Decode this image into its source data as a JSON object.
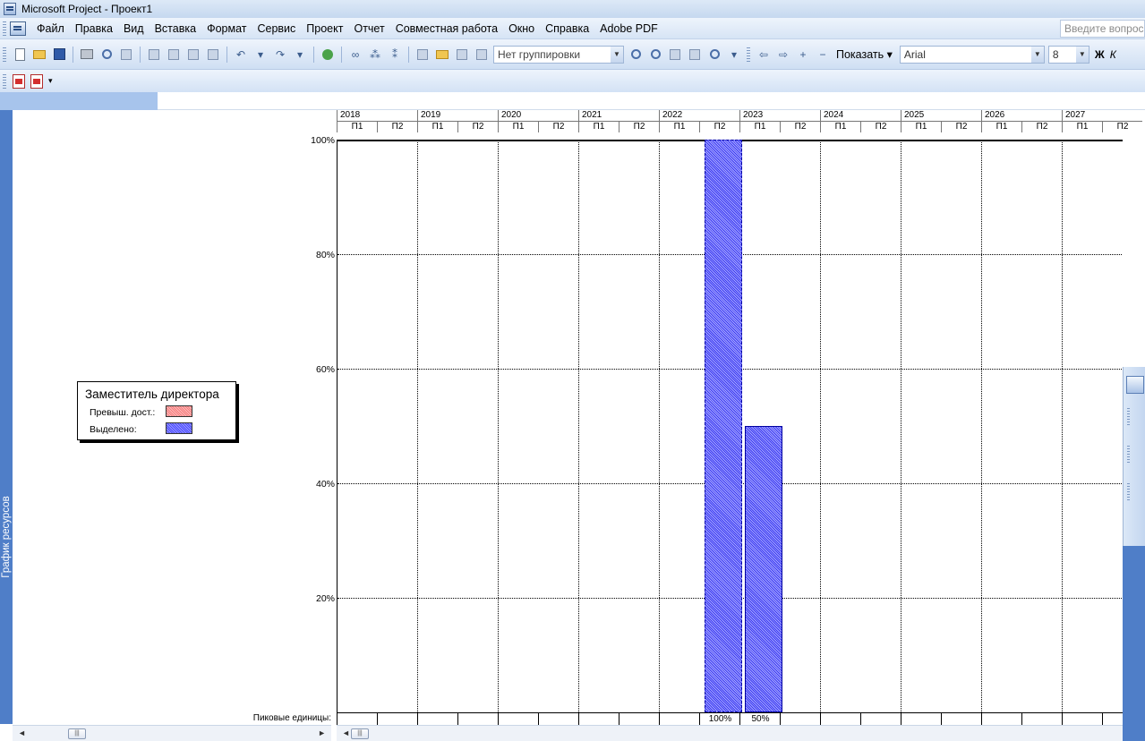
{
  "window": {
    "title": "Microsoft Project - Проект1"
  },
  "menu": {
    "items": [
      {
        "label": "Файл"
      },
      {
        "label": "Правка"
      },
      {
        "label": "Вид"
      },
      {
        "label": "Вставка"
      },
      {
        "label": "Формат"
      },
      {
        "label": "Сервис"
      },
      {
        "label": "Проект"
      },
      {
        "label": "Отчет"
      },
      {
        "label": "Совместная работа"
      },
      {
        "label": "Окно"
      },
      {
        "label": "Справка"
      },
      {
        "label": "Adobe PDF"
      }
    ],
    "ask_placeholder": "Введите вопрос"
  },
  "toolbar": {
    "grouping": "Нет группировки",
    "show_label": "Показать",
    "font": "Arial",
    "font_size": "8",
    "bold": "Ж",
    "italic": "К"
  },
  "view": {
    "side_label": "График ресурсов"
  },
  "legend": {
    "resource": "Заместитель директора",
    "overallocated": "Превыш. дост.:",
    "allocated": "Выделено:"
  },
  "colors": {
    "allocated": "#4b4bff",
    "overallocated": "#ff7f7f",
    "sidebar": "#4f7ec8"
  },
  "timescale": {
    "years": [
      "2018",
      "2019",
      "2020",
      "2021",
      "2022",
      "2023",
      "2024",
      "2025",
      "2026",
      "2027"
    ],
    "halves": [
      "П1",
      "П2"
    ]
  },
  "chart_data": {
    "type": "bar",
    "title": "",
    "xlabel": "",
    "ylabel": "",
    "ylim": [
      0,
      100
    ],
    "y_ticks": [
      "100%",
      "80%",
      "60%",
      "40%",
      "20%"
    ],
    "periods": [
      "2018 П1",
      "2018 П2",
      "2019 П1",
      "2019 П2",
      "2020 П1",
      "2020 П2",
      "2021 П1",
      "2021 П2",
      "2022 П1",
      "2022 П2",
      "2023 П1",
      "2023 П2",
      "2024 П1",
      "2024 П2",
      "2025 П1",
      "2025 П2",
      "2026 П1",
      "2026 П2",
      "2027 П1",
      "2027 П2"
    ],
    "series": [
      {
        "name": "Выделено",
        "values": [
          0,
          0,
          0,
          0,
          0,
          0,
          0,
          0,
          0,
          100,
          50,
          0,
          0,
          0,
          0,
          0,
          0,
          0,
          0,
          0
        ]
      }
    ]
  },
  "peak": {
    "label": "Пиковые единицы:",
    "values": [
      "",
      "",
      "",
      "",
      "",
      "",
      "",
      "",
      "",
      "100%",
      "50%",
      "",
      "",
      "",
      "",
      "",
      "",
      "",
      "",
      ""
    ]
  }
}
